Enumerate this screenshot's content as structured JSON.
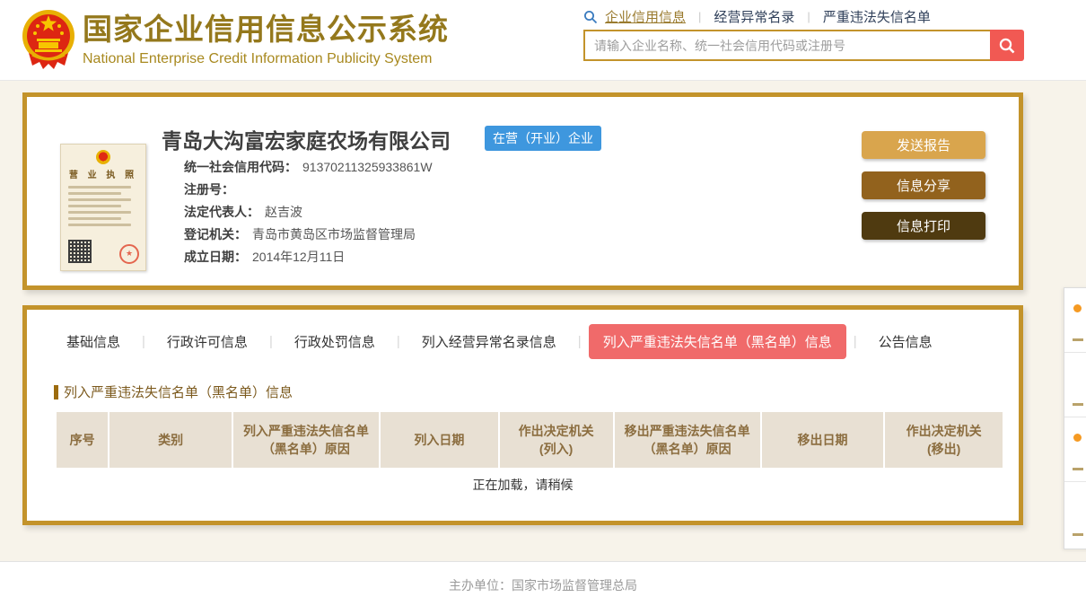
{
  "header": {
    "title": "国家企业信用信息公示系统",
    "subtitle": "National Enterprise Credit Information Publicity System",
    "nav": [
      {
        "label": "企业信用信息",
        "active": true
      },
      {
        "label": "经营异常名录",
        "active": false
      },
      {
        "label": "严重违法失信名单",
        "active": false
      }
    ],
    "search": {
      "placeholder": "请输入企业名称、统一社会信用代码或注册号",
      "value": ""
    }
  },
  "company": {
    "name": "青岛大沟富宏家庭农场有限公司",
    "status_badge": "在营（开业）企业",
    "license_title": "营 业 执 照",
    "fields": [
      {
        "label": "统一社会信用代码：",
        "value": "91370211325933861W"
      },
      {
        "label": "注册号：",
        "value": ""
      },
      {
        "label": "法定代表人：",
        "value": "赵吉波"
      },
      {
        "label": "登记机关：",
        "value": "青岛市黄岛区市场监督管理局"
      },
      {
        "label": "成立日期：",
        "value": "2014年12月11日"
      }
    ],
    "actions": [
      {
        "label": "发送报告"
      },
      {
        "label": "信息分享"
      },
      {
        "label": "信息打印"
      }
    ]
  },
  "tabs": [
    {
      "label": "基础信息",
      "active": false
    },
    {
      "label": "行政许可信息",
      "active": false
    },
    {
      "label": "行政处罚信息",
      "active": false
    },
    {
      "label": "列入经营异常名录信息",
      "active": false
    },
    {
      "label": "列入严重违法失信名单（黑名单）信息",
      "active": true
    },
    {
      "label": "公告信息",
      "active": false
    }
  ],
  "section": {
    "title": "列入严重违法失信名单（黑名单）信息",
    "table": {
      "columns": [
        {
          "label": "序号"
        },
        {
          "label": "类别"
        },
        {
          "label": "列入严重违法失信名单（黑名单）原因"
        },
        {
          "label": "列入日期"
        },
        {
          "label": "作出决定机关\n(列入)"
        },
        {
          "label": "移出严重违法失信名单（黑名单）原因"
        },
        {
          "label": "移出日期"
        },
        {
          "label": "作出决定机关\n(移出)"
        }
      ]
    },
    "loading": "正在加载，请稍候"
  },
  "footer": {
    "text": "主办单位：国家市场监督管理总局"
  },
  "colors": {
    "accent_gold": "#c3932b",
    "title_gold": "#94781c",
    "badge_blue": "#3e97de",
    "search_red": "#f15953",
    "active_tab_red": "#f06a6a",
    "btn_tan": "#d9a54d",
    "btn_brown": "#92621d",
    "btn_dark": "#4f3a10",
    "table_header_bg": "#e8e0d3",
    "table_header_text": "#8b6d3f"
  }
}
